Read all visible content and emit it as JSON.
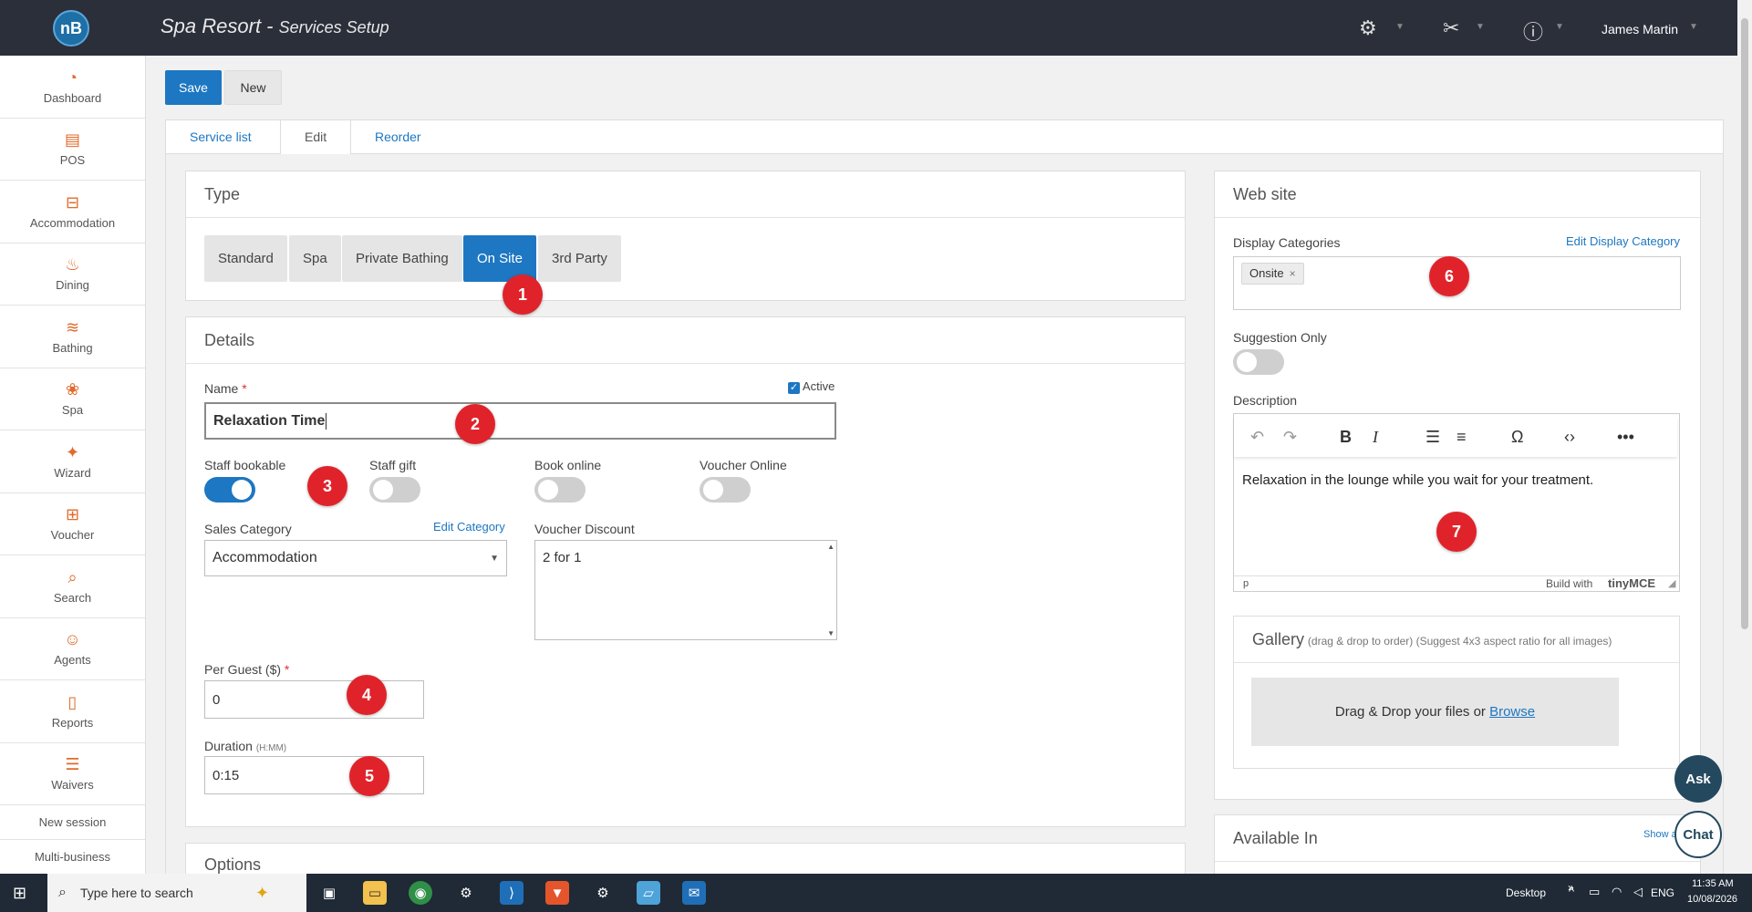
{
  "header": {
    "logo_text": "nB",
    "app_name": "Spa Resort",
    "separator": " - ",
    "page_name": "Services Setup",
    "user_name": "James Martin",
    "icons": [
      "gears-icon",
      "tools-icon",
      "help-icon"
    ]
  },
  "sidebar": {
    "items": [
      {
        "label": "Dashboard",
        "icon": "gauge-icon",
        "glyph": "◔"
      },
      {
        "label": "POS",
        "icon": "cash-register-icon",
        "glyph": "▤"
      },
      {
        "label": "Accommodation",
        "icon": "bed-icon",
        "glyph": "⊟"
      },
      {
        "label": "Dining",
        "icon": "dining-icon",
        "glyph": "♨"
      },
      {
        "label": "Bathing",
        "icon": "water-icon",
        "glyph": "≋"
      },
      {
        "label": "Spa",
        "icon": "lotus-icon",
        "glyph": "❀"
      },
      {
        "label": "Wizard",
        "icon": "wand-icon",
        "glyph": "✦"
      },
      {
        "label": "Voucher",
        "icon": "gift-icon",
        "glyph": "⊞"
      },
      {
        "label": "Search",
        "icon": "search-icon",
        "glyph": "⌕"
      },
      {
        "label": "Agents",
        "icon": "users-icon",
        "glyph": "☺"
      },
      {
        "label": "Reports",
        "icon": "report-icon",
        "glyph": "▯"
      },
      {
        "label": "Waivers",
        "icon": "list-check-icon",
        "glyph": "☰"
      }
    ],
    "links": [
      "New session",
      "Multi-business"
    ]
  },
  "toolbar": {
    "save_label": "Save",
    "new_label": "New"
  },
  "tabs": {
    "service_list": "Service list",
    "edit": "Edit",
    "reorder": "Reorder"
  },
  "type_panel": {
    "heading": "Type",
    "options": [
      "Standard",
      "Spa",
      "Private Bathing",
      "On Site",
      "3rd Party"
    ],
    "selected": "On Site"
  },
  "details": {
    "heading": "Details",
    "name_label": "Name",
    "required_mark": "*",
    "active_label": "Active",
    "name_value": "Relaxation Time",
    "toggles": {
      "staff_bookable": "Staff bookable",
      "staff_gift": "Staff gift",
      "book_online": "Book online",
      "voucher_online": "Voucher Online"
    },
    "sales_category_label": "Sales Category",
    "edit_category_link": "Edit Category",
    "sales_category_value": "Accommodation",
    "voucher_discount_label": "Voucher Discount",
    "voucher_discount_value": "2 for 1",
    "per_guest_label": "Per Guest ($)",
    "per_guest_value": "0",
    "duration_label": "Duration",
    "duration_hint": "(H:MM)",
    "duration_value": "0:15"
  },
  "options_heading": "Options",
  "website": {
    "heading": "Web site",
    "display_categories_label": "Display Categories",
    "edit_display_category_link": "Edit Display Category",
    "category_chip": "Onsite",
    "chip_remove": "×",
    "suggestion_only_label": "Suggestion Only",
    "description_label": "Description",
    "description_text": "Relaxation in the lounge while you wait for your treatment.",
    "editor_path": "p",
    "editor_brand": "Build with",
    "editor_brand_name": "tinyMCE",
    "gallery_heading": "Gallery",
    "gallery_hint": "(drag & drop to order) (Suggest 4x3 aspect ratio for all images)",
    "dropzone_text": "Drag & Drop your files or",
    "browse_link": "Browse"
  },
  "available_in": {
    "heading": "Available In",
    "show_link": "Show a"
  },
  "badges": [
    "1",
    "2",
    "3",
    "4",
    "5",
    "6",
    "7"
  ],
  "float_buttons": {
    "ask": "Ask",
    "chat": "Chat"
  },
  "taskbar": {
    "search_placeholder": "Type here to search",
    "desktop_label": "Desktop",
    "language": "ENG",
    "time": "11:35 AM",
    "date": "10/08/2026"
  },
  "colors": {
    "accent": "#1d77c2",
    "topbar": "#2b2f3a",
    "badge": "#e0232a",
    "sidebar_icon": "#e06b2d"
  }
}
